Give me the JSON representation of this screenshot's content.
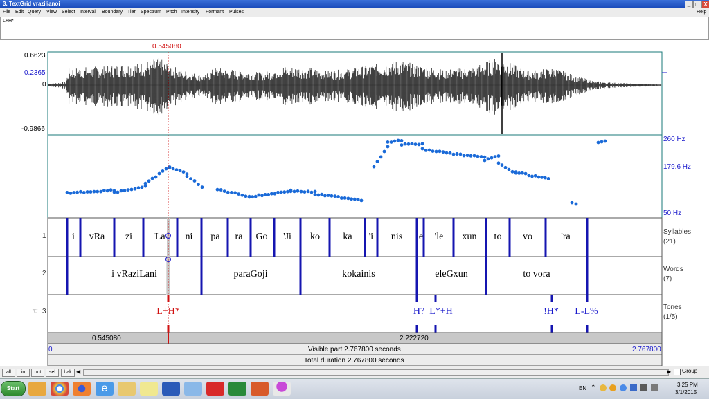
{
  "window": {
    "title": "3. TextGrid vrazilianoi",
    "buttons": [
      "_",
      "□",
      "X"
    ]
  },
  "menu": {
    "items": [
      "File",
      "Edit",
      "Query",
      "View",
      "Select",
      "Interval",
      "Boundary",
      "Tier",
      "Spectrum",
      "Pitch",
      "Intensity",
      "Formant",
      "Pulses"
    ],
    "help": "Help"
  },
  "text_area": {
    "value": "L+H*"
  },
  "waveform": {
    "max_label": "0.6623",
    "cursor_level_label": "0.2365",
    "zero_label": "0",
    "min_label": "-0.9866"
  },
  "cursor": {
    "time_label": "0.545080",
    "time_s": 0.54508
  },
  "pitch": {
    "top_label": "260 Hz",
    "mid_label": "179.6 Hz",
    "bottom_label": "50 Hz",
    "range_hz": [
      50,
      260
    ]
  },
  "tiers": [
    {
      "number": "1",
      "name": "Syllables",
      "count": "(21)",
      "intervals": [
        "i",
        "vRa",
        "zi",
        "'La",
        "ni",
        "pa",
        "ra",
        "Go",
        "'Ji",
        "ko",
        "ka",
        "'i",
        "nis",
        "e",
        "'le",
        "xun",
        "to",
        "vo",
        "'ra"
      ]
    },
    {
      "number": "2",
      "name": "Words",
      "count": "(7)",
      "intervals": [
        "i vRaziLani",
        "paraGoji",
        "kokainis",
        "eleGxun",
        "to vora"
      ]
    },
    {
      "number": "3",
      "name": "Tones",
      "count": "(1/5)",
      "points": [
        "L+H*",
        "H?",
        "L*+H",
        "!H*",
        "L-L%"
      ]
    }
  ],
  "time_axis": {
    "left_segment": "0.545080",
    "right_segment": "2.222720",
    "visible_start": "0",
    "visible_label": "Visible part 2.767800 seconds",
    "visible_end": "2.767800",
    "total_label": "Total duration 2.767800 seconds"
  },
  "bottom_buttons": [
    "all",
    "in",
    "out",
    "sel",
    "bak"
  ],
  "group_label": "Group",
  "taskbar": {
    "start_label": "Start",
    "language": "EN",
    "time": "3:25 PM",
    "date": "3/1/2015"
  }
}
